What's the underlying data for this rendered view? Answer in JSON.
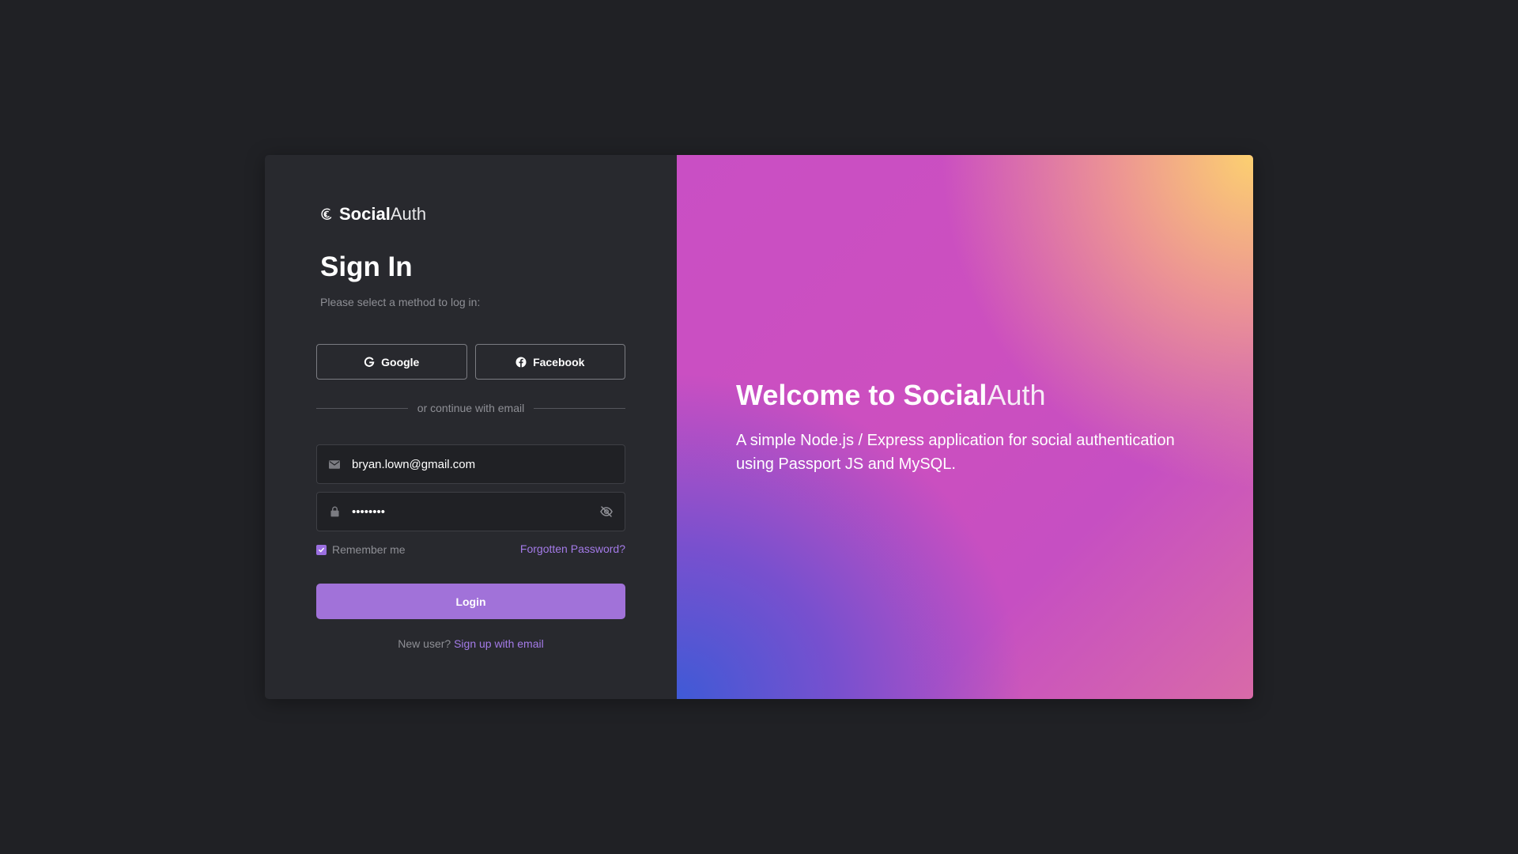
{
  "brand": {
    "name_strong": "Social",
    "name_light": "Auth",
    "icon": "fingerprint-icon"
  },
  "signin": {
    "title": "Sign In",
    "subtitle": "Please select a method to log in:",
    "google_label": "Google",
    "facebook_label": "Facebook",
    "divider_text": "or continue with email",
    "email_value": "bryan.lown@gmail.com",
    "password_value": "••••••••",
    "remember_label": "Remember me",
    "remember_checked": true,
    "forgot_label": "Forgotten Password?",
    "login_label": "Login",
    "new_user_text": "New user?",
    "signup_link": "Sign up with email"
  },
  "hero": {
    "title_strong": "Welcome to Social",
    "title_light": "Auth",
    "description": "A simple Node.js / Express application for social authentication using Passport JS and MySQL."
  },
  "colors": {
    "background": "#202125",
    "panel": "#28292e",
    "accent": "#a172d9",
    "link": "#a47be8",
    "gradient": [
      "#fcd070",
      "#c94fc4",
      "#3f5ad6"
    ]
  }
}
